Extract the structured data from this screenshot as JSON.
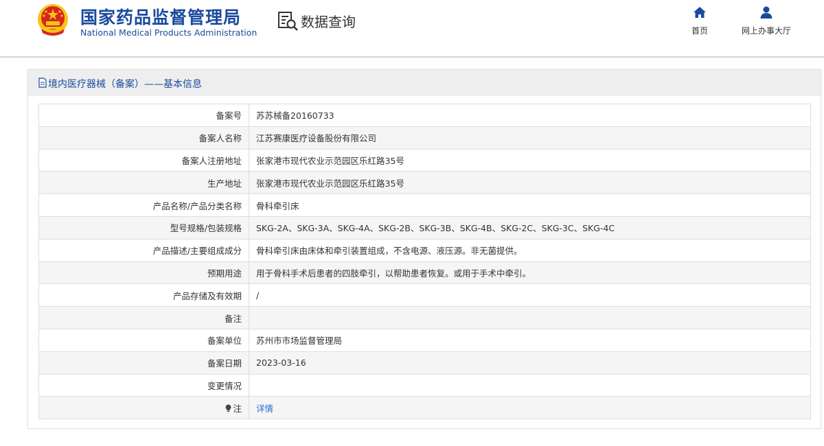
{
  "header": {
    "agency_cn": "国家药品监督管理局",
    "agency_en": "National Medical Products Administration",
    "query_title": "数据查询",
    "nav": [
      {
        "label": "首页",
        "icon": "home-icon"
      },
      {
        "label": "网上办事大厅",
        "icon": "user-icon"
      }
    ]
  },
  "panel": {
    "title": "境内医疗器械（备案）——基本信息",
    "icon": "document-icon"
  },
  "rows": [
    {
      "key": "备案号",
      "value": "苏苏械备20160733"
    },
    {
      "key": "备案人名称",
      "value": "江苏赛康医疗设备股份有限公司"
    },
    {
      "key": "备案人注册地址",
      "value": "张家港市现代农业示范园区乐红路35号"
    },
    {
      "key": "生产地址",
      "value": "张家港市现代农业示范园区乐红路35号"
    },
    {
      "key": "产品名称/产品分类名称",
      "value": "骨科牵引床"
    },
    {
      "key": "型号规格/包装规格",
      "value": "SKG-2A、SKG-3A、SKG-4A、SKG-2B、SKG-3B、SKG-4B、SKG-2C、SKG-3C、SKG-4C"
    },
    {
      "key": "产品描述/主要组成成分",
      "value": "骨科牵引床由床体和牵引装置组成，不含电源、液压源。非无菌提供。"
    },
    {
      "key": "预期用途",
      "value": "用于骨科手术后患者的四肢牵引，以帮助患者恢复。或用于手术中牵引。"
    },
    {
      "key": "产品存储及有效期",
      "value": "/"
    },
    {
      "key": "备注",
      "value": ""
    },
    {
      "key": "备案单位",
      "value": "苏州市市场监督管理局"
    },
    {
      "key": "备案日期",
      "value": "2023-03-16"
    },
    {
      "key": "变更情况",
      "value": ""
    },
    {
      "key": "注",
      "value": "详情",
      "icon": "lightbulb-icon"
    }
  ],
  "colors": {
    "brand_blue": "#1a4a9e",
    "link_blue": "#2a6fc9",
    "emblem_red": "#d7261e",
    "emblem_gold": "#f5c518"
  }
}
